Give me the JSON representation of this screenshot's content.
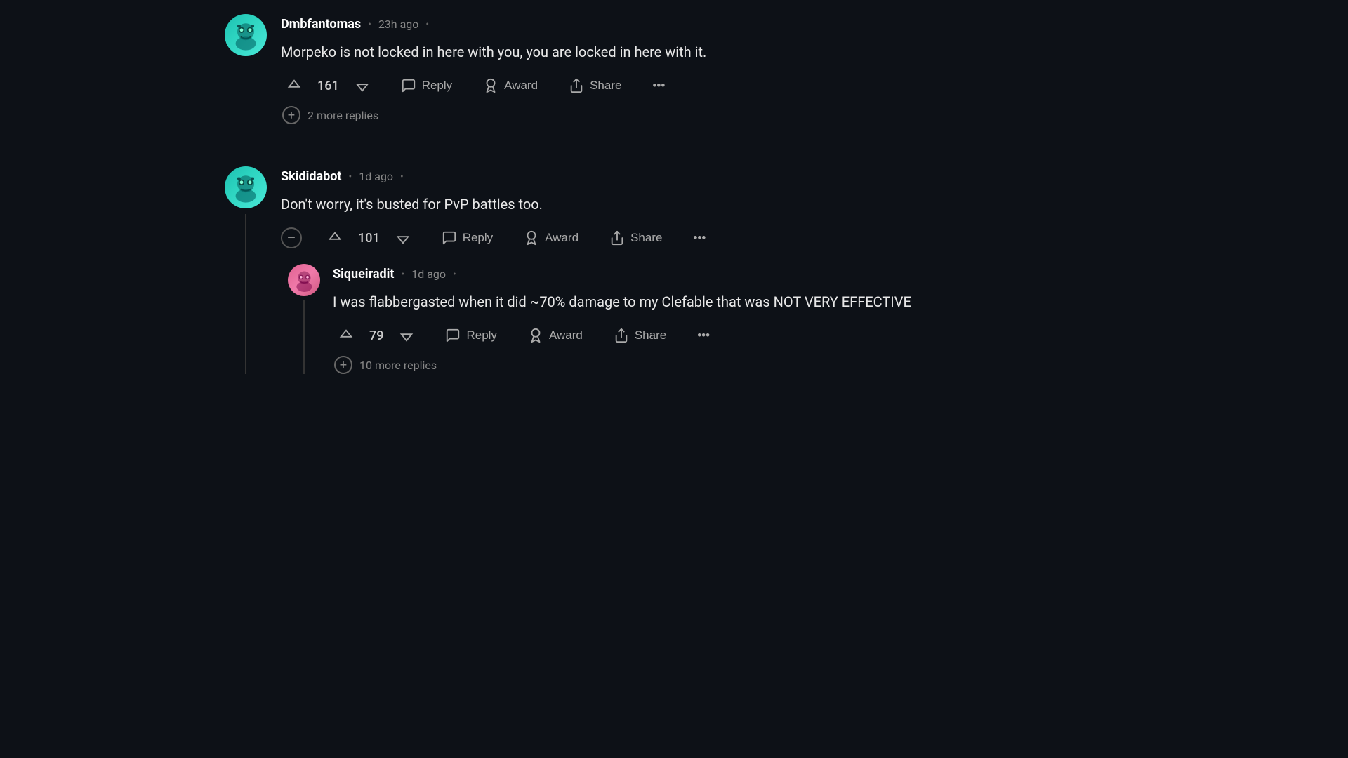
{
  "comments": [
    {
      "id": "comment-1",
      "username": "Dmbfantomas",
      "timestamp": "23h ago",
      "text": "Morpeko is not locked in here with you, you are locked in here with it.",
      "upvotes": 161,
      "actions": [
        "Reply",
        "Award",
        "Share"
      ],
      "more_replies": "2 more replies",
      "has_thread_line": false,
      "avatar_color": "teal"
    },
    {
      "id": "comment-2",
      "username": "Skididabot",
      "timestamp": "1d ago",
      "text": "Don't worry, it's busted for PvP battles too.",
      "upvotes": 101,
      "actions": [
        "Reply",
        "Award",
        "Share"
      ],
      "has_collapse": true,
      "avatar_color": "teal",
      "nested": [
        {
          "id": "comment-2-1",
          "username": "Siqueiradit",
          "timestamp": "1d ago",
          "text": "I was flabbergasted when it did ~70% damage to my Clefable that was NOT VERY EFFECTIVE",
          "upvotes": 79,
          "actions": [
            "Reply",
            "Award",
            "Share"
          ],
          "more_replies": "10 more replies",
          "avatar_color": "pink"
        }
      ]
    }
  ],
  "actions": {
    "reply": "Reply",
    "award": "Award",
    "share": "Share",
    "more": "...",
    "collapse": "−"
  },
  "colors": {
    "bg": "#0d1117",
    "text_primary": "#e8e8e8",
    "text_muted": "#888888",
    "thread_line": "#333333"
  }
}
